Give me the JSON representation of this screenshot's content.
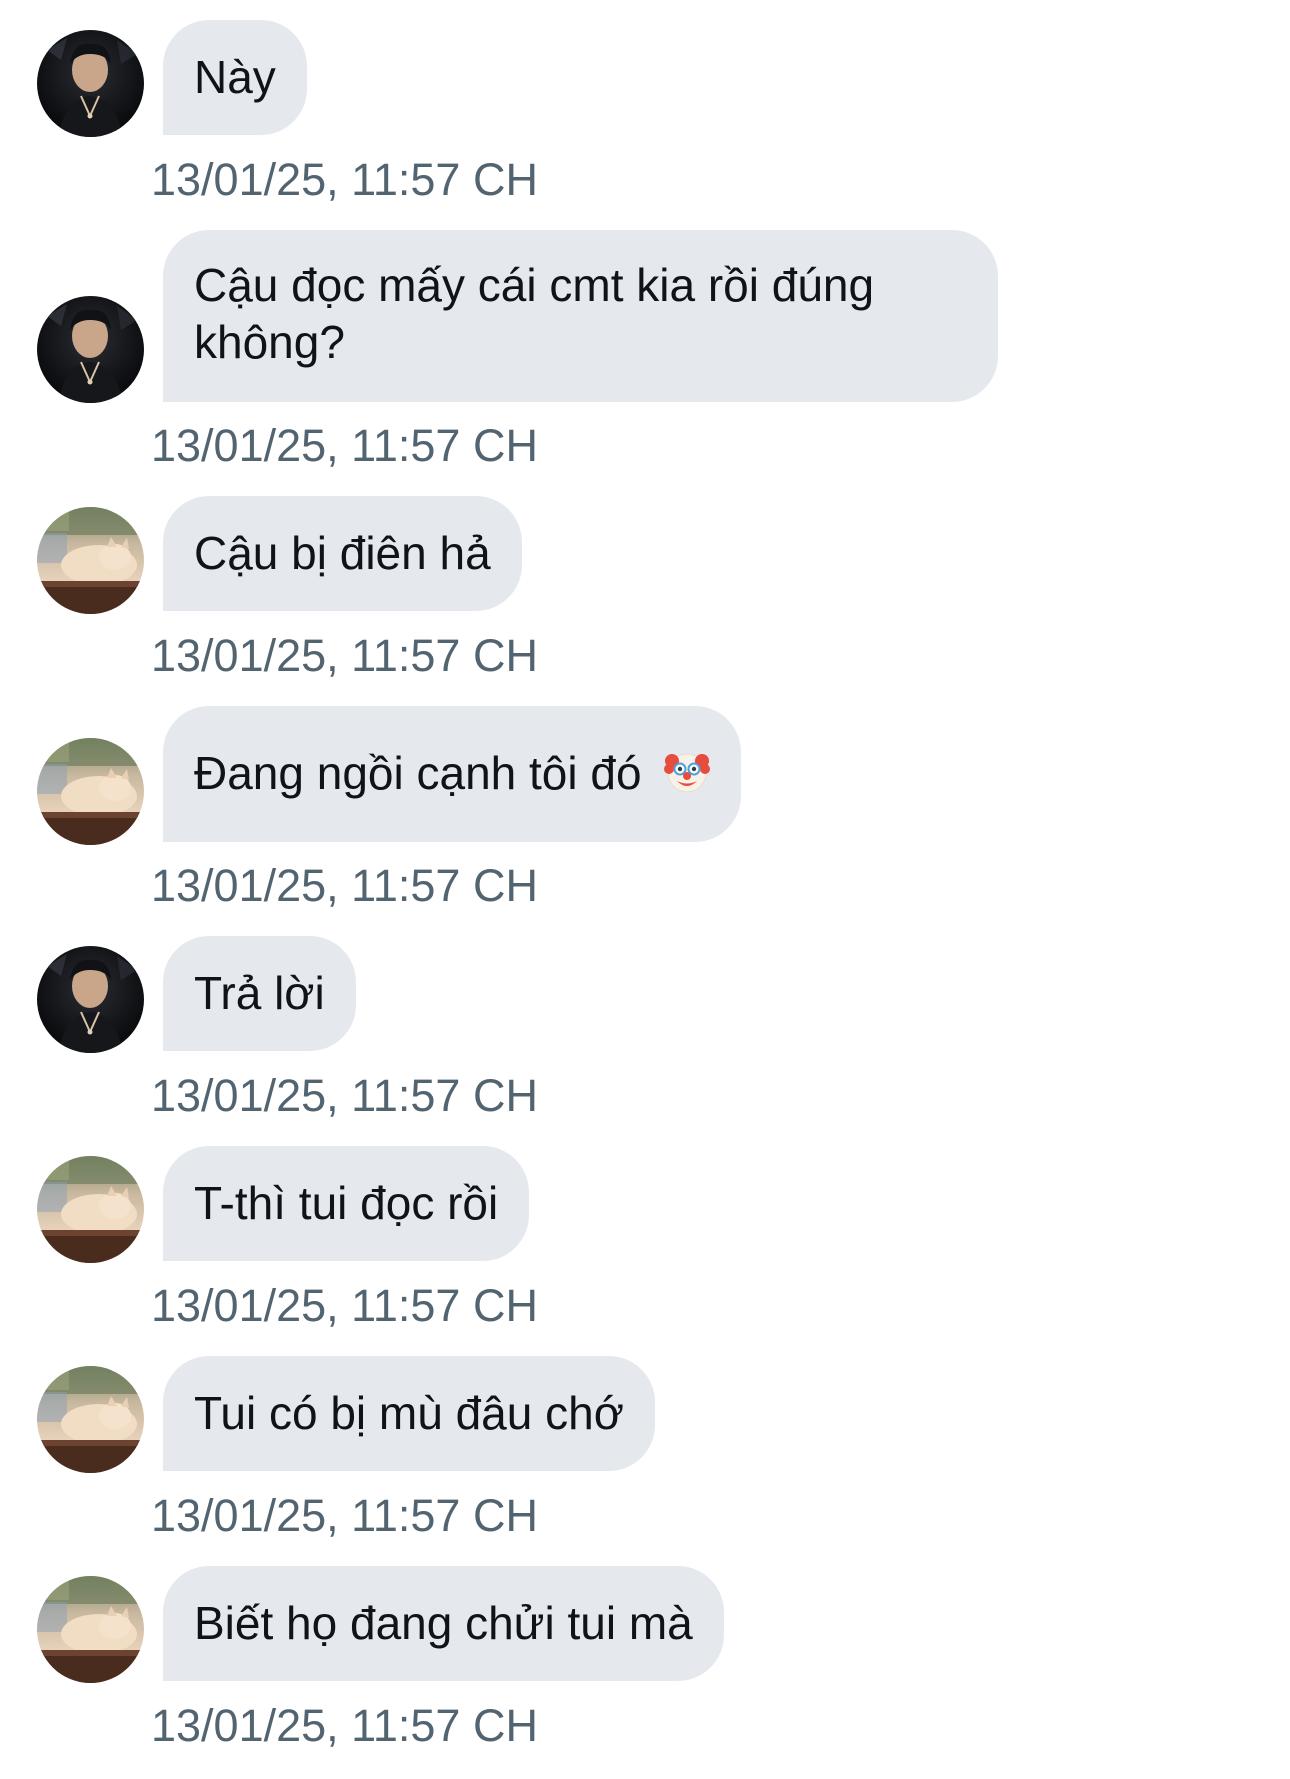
{
  "avatars": {
    "a": {
      "icon": "user-avatar-dark-portrait"
    },
    "b": {
      "icon": "user-avatar-cat-photo"
    }
  },
  "messages": [
    {
      "sender": "a",
      "text": "Này",
      "time": "13/01/25, 11:57 CH"
    },
    {
      "sender": "a",
      "text": "Cậu đọc mấy cái cmt kia rồi đúng không?",
      "time": "13/01/25, 11:57 CH"
    },
    {
      "sender": "b",
      "text": "Cậu bị điên hả",
      "time": "13/01/25, 11:57 CH"
    },
    {
      "sender": "b",
      "text": "Đang ngồi cạnh tôi đó",
      "emoji": "clown-face-emoji",
      "time": "13/01/25, 11:57 CH"
    },
    {
      "sender": "a",
      "text": "Trả lời",
      "time": "13/01/25, 11:57 CH"
    },
    {
      "sender": "b",
      "text": "T-thì tui đọc rồi",
      "time": "13/01/25, 11:57 CH"
    },
    {
      "sender": "b",
      "text": "Tui có bị mù đâu chớ",
      "time": "13/01/25, 11:57 CH"
    },
    {
      "sender": "b",
      "text": "Biết họ đang chửi tui mà",
      "time": "13/01/25, 11:57 CH"
    }
  ],
  "colors": {
    "bubble": "#e5e9ee",
    "text": "#0f1419",
    "timestamp": "#536471"
  }
}
